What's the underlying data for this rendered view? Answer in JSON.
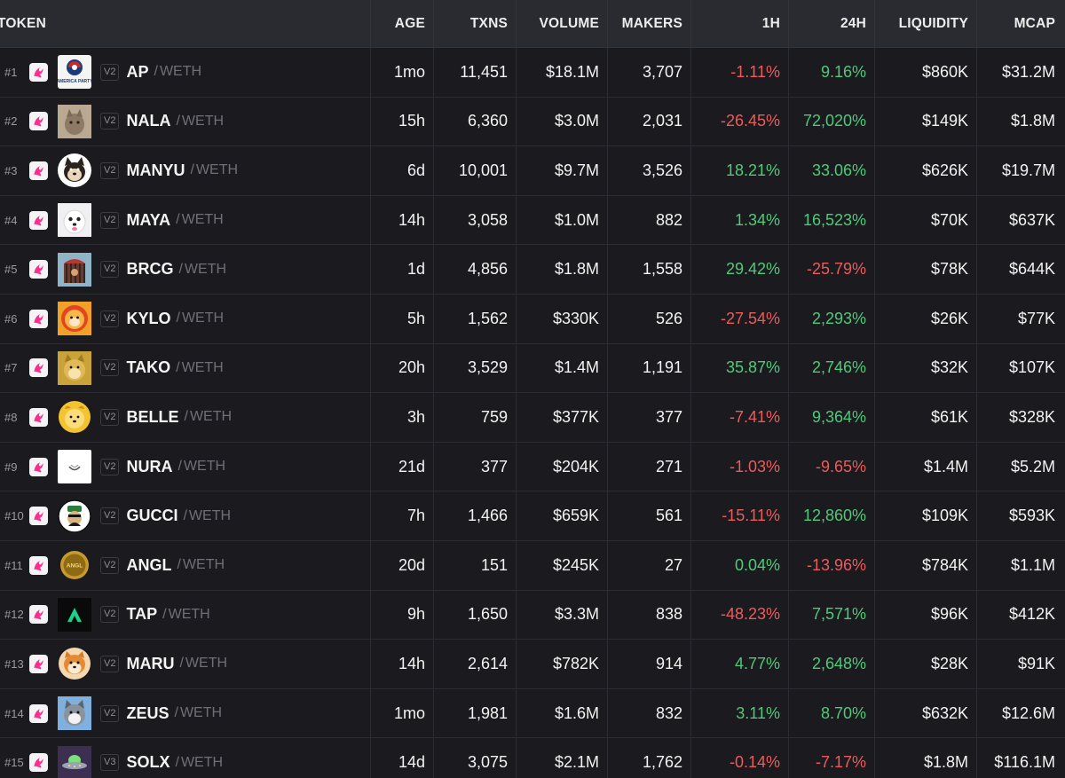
{
  "colors": {
    "positive": "#4fc97a",
    "negative": "#ec5b5b",
    "header_bg": "#2a2b30",
    "row_bg": "#1b1b1f"
  },
  "headers": {
    "token": "TOKEN",
    "age": "AGE",
    "txns": "TXNS",
    "volume": "VOLUME",
    "makers": "MAKERS",
    "h1": "1H",
    "h24": "24H",
    "liquidity": "LIQUIDITY",
    "mcap": "MCAP"
  },
  "rows": [
    {
      "rank": "#1",
      "ver": "V2",
      "symbol": "AP",
      "quote": "WETH",
      "age": "1mo",
      "txns": "11,451",
      "volume": "$18.1M",
      "makers": "3,707",
      "h1": "-1.11%",
      "h24": "9.16%",
      "liquidity": "$860K",
      "mcap": "$31.2M",
      "logo": "america-party-logo",
      "logo_text": "AMERICA PARTY"
    },
    {
      "rank": "#2",
      "ver": "V2",
      "symbol": "NALA",
      "quote": "WETH",
      "age": "15h",
      "txns": "6,360",
      "volume": "$3.0M",
      "makers": "2,031",
      "h1": "-26.45%",
      "h24": "72,020%",
      "liquidity": "$149K",
      "mcap": "$1.8M",
      "logo": "cat-logo"
    },
    {
      "rank": "#3",
      "ver": "V2",
      "symbol": "MANYU",
      "quote": "WETH",
      "age": "6d",
      "txns": "10,001",
      "volume": "$9.7M",
      "makers": "3,526",
      "h1": "18.21%",
      "h24": "33.06%",
      "liquidity": "$626K",
      "mcap": "$19.7M",
      "logo": "shiba-logo"
    },
    {
      "rank": "#4",
      "ver": "V2",
      "symbol": "MAYA",
      "quote": "WETH",
      "age": "14h",
      "txns": "3,058",
      "volume": "$1.0M",
      "makers": "882",
      "h1": "1.34%",
      "h24": "16,523%",
      "liquidity": "$70K",
      "mcap": "$637K",
      "logo": "white-dog-logo"
    },
    {
      "rank": "#5",
      "ver": "V2",
      "symbol": "BRCG",
      "quote": "WETH",
      "age": "1d",
      "txns": "4,856",
      "volume": "$1.8M",
      "makers": "1,558",
      "h1": "29.42%",
      "h24": "-25.79%",
      "liquidity": "$78K",
      "mcap": "$644K",
      "logo": "cage-logo"
    },
    {
      "rank": "#6",
      "ver": "V2",
      "symbol": "KYLO",
      "quote": "WETH",
      "age": "5h",
      "txns": "1,562",
      "volume": "$330K",
      "makers": "526",
      "h1": "-27.54%",
      "h24": "2,293%",
      "liquidity": "$26K",
      "mcap": "$77K",
      "logo": "shib-badge-logo"
    },
    {
      "rank": "#7",
      "ver": "V2",
      "symbol": "TAKO",
      "quote": "WETH",
      "age": "20h",
      "txns": "3,529",
      "volume": "$1.4M",
      "makers": "1,191",
      "h1": "35.87%",
      "h24": "2,746%",
      "liquidity": "$32K",
      "mcap": "$107K",
      "logo": "doge-logo"
    },
    {
      "rank": "#8",
      "ver": "V2",
      "symbol": "BELLE",
      "quote": "WETH",
      "age": "3h",
      "txns": "759",
      "volume": "$377K",
      "makers": "377",
      "h1": "-7.41%",
      "h24": "9,364%",
      "liquidity": "$61K",
      "mcap": "$328K",
      "logo": "yellow-dog-logo"
    },
    {
      "rank": "#9",
      "ver": "V2",
      "symbol": "NURA",
      "quote": "WETH",
      "age": "21d",
      "txns": "377",
      "volume": "$204K",
      "makers": "271",
      "h1": "-1.03%",
      "h24": "-9.65%",
      "liquidity": "$1.4M",
      "mcap": "$5.2M",
      "logo": "nura-logo"
    },
    {
      "rank": "#10",
      "ver": "V2",
      "symbol": "GUCCI",
      "quote": "WETH",
      "age": "7h",
      "txns": "1,466",
      "volume": "$659K",
      "makers": "561",
      "h1": "-15.11%",
      "h24": "12,860%",
      "liquidity": "$109K",
      "mcap": "$593K",
      "logo": "gucci-logo"
    },
    {
      "rank": "#11",
      "ver": "V2",
      "symbol": "ANGL",
      "quote": "WETH",
      "age": "20d",
      "txns": "151",
      "volume": "$245K",
      "makers": "27",
      "h1": "0.04%",
      "h24": "-13.96%",
      "liquidity": "$784K",
      "mcap": "$1.1M",
      "logo": "angl-coin-logo",
      "logo_text": "ANGL"
    },
    {
      "rank": "#12",
      "ver": "V2",
      "symbol": "TAP",
      "quote": "WETH",
      "age": "9h",
      "txns": "1,650",
      "volume": "$3.3M",
      "makers": "838",
      "h1": "-48.23%",
      "h24": "7,571%",
      "liquidity": "$96K",
      "mcap": "$412K",
      "logo": "tap-logo"
    },
    {
      "rank": "#13",
      "ver": "V2",
      "symbol": "MARU",
      "quote": "WETH",
      "age": "14h",
      "txns": "2,614",
      "volume": "$782K",
      "makers": "914",
      "h1": "4.77%",
      "h24": "2,648%",
      "liquidity": "$28K",
      "mcap": "$91K",
      "logo": "maru-dog-logo"
    },
    {
      "rank": "#14",
      "ver": "V2",
      "symbol": "ZEUS",
      "quote": "WETH",
      "age": "1mo",
      "txns": "1,981",
      "volume": "$1.6M",
      "makers": "832",
      "h1": "3.11%",
      "h24": "8.70%",
      "liquidity": "$632K",
      "mcap": "$12.6M",
      "logo": "zeus-dog-logo"
    },
    {
      "rank": "#15",
      "ver": "V3",
      "symbol": "SOLX",
      "quote": "WETH",
      "age": "14d",
      "txns": "3,075",
      "volume": "$2.1M",
      "makers": "1,762",
      "h1": "-0.14%",
      "h24": "-7.17%",
      "liquidity": "$1.8M",
      "mcap": "$116.1M",
      "logo": "ufo-logo"
    }
  ]
}
